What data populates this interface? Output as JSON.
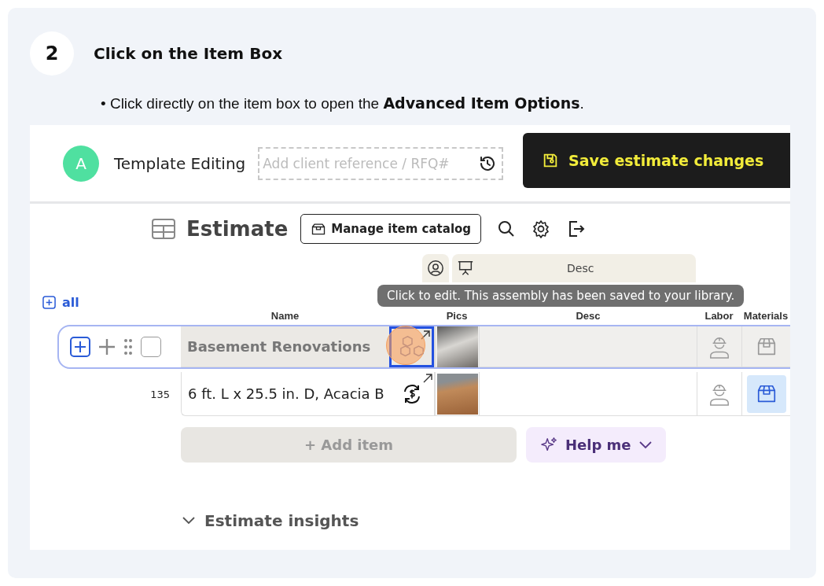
{
  "step": {
    "number": "2",
    "title": "Click on the Item Box",
    "instruction": "• Click directly on the item box to open the **Advanced Item Options**."
  },
  "app": {
    "header": {
      "avatar": "A",
      "title": "Template Editing",
      "reference_field": {
        "placeholder": "Add client reference / RFQ#"
      },
      "save_button": "Save estimate changes"
    },
    "toolbar": {
      "title": "Estimate",
      "catalog_button": "Manage item catalog"
    },
    "column_bar": {
      "label": "Desc"
    },
    "expand_all": "all",
    "tooltip": "Click to edit. This assembly has been saved to your library.",
    "columns": [
      "Name",
      "Pics",
      "Desc",
      "Labor",
      "Materials"
    ],
    "rows": [
      {
        "kind": "assembly",
        "number": "",
        "name": "Basement Renovations",
        "selected": true,
        "materials_selected": false
      },
      {
        "kind": "item",
        "number": "135",
        "name": "6 ft. L x 25.5 in. D, Acacia B",
        "selected": false,
        "materials_selected": true
      }
    ],
    "add_button": "+ Add item",
    "help_button": "Help me",
    "insights": "Estimate insights"
  }
}
